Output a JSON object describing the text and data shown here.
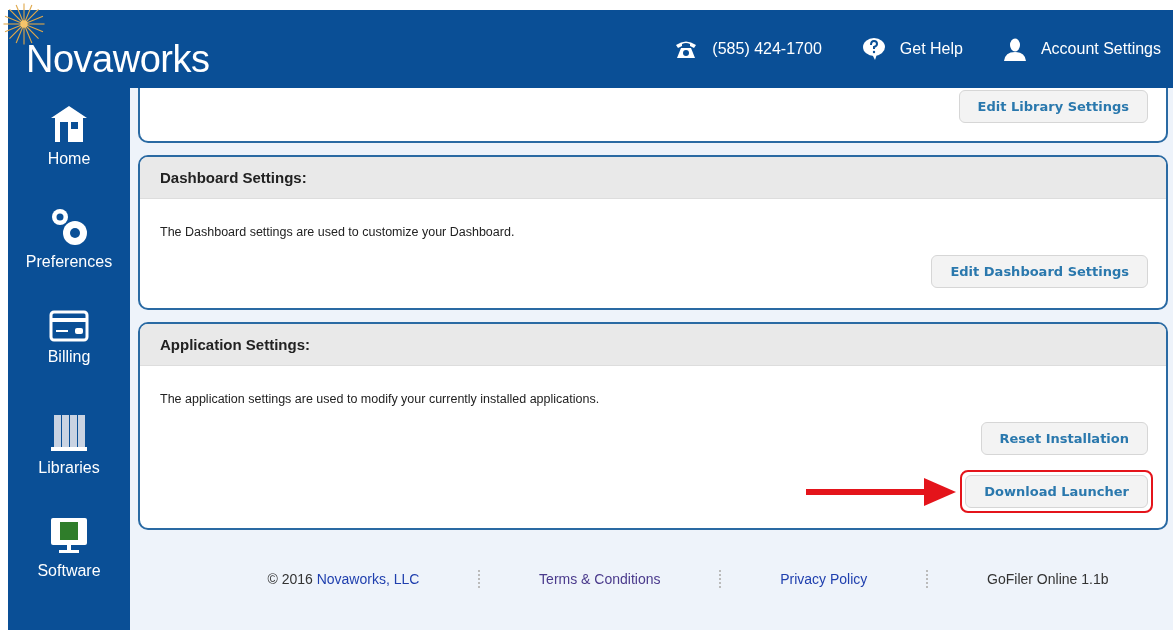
{
  "header": {
    "logo": "Novaworks",
    "links": [
      {
        "kind": "phone",
        "label": "(585) 424-1700"
      },
      {
        "kind": "help",
        "label": "Get Help"
      },
      {
        "kind": "account",
        "label": "Account Settings"
      }
    ]
  },
  "sidebar": {
    "items": [
      {
        "kind": "home",
        "label": "Home"
      },
      {
        "kind": "preferences",
        "label": "Preferences"
      },
      {
        "kind": "billing",
        "label": "Billing"
      },
      {
        "kind": "libraries",
        "label": "Libraries"
      },
      {
        "kind": "software",
        "label": "Software"
      }
    ]
  },
  "panels": [
    {
      "cut_top": true,
      "buttons": [
        {
          "label": "Edit Library Settings",
          "highlighted": false
        }
      ]
    },
    {
      "cut_top": false,
      "title": "Dashboard Settings:",
      "description": "The Dashboard settings are used to customize your Dashboard.",
      "buttons": [
        {
          "label": "Edit Dashboard Settings",
          "highlighted": false
        }
      ]
    },
    {
      "cut_top": false,
      "title": "Application Settings:",
      "description": "The application settings are used to modify your currently installed applications.",
      "buttons": [
        {
          "label": "Reset Installation",
          "highlighted": false
        },
        {
          "label": "Download Launcher",
          "highlighted": true
        }
      ]
    }
  ],
  "footer": {
    "copyright": "© 2016",
    "company": "Novaworks, LLC",
    "links": [
      {
        "label": "Terms & Conditions",
        "visited": true
      },
      {
        "label": "Privacy Policy",
        "visited": false
      }
    ],
    "version": "GoFiler Online 1.1b"
  }
}
